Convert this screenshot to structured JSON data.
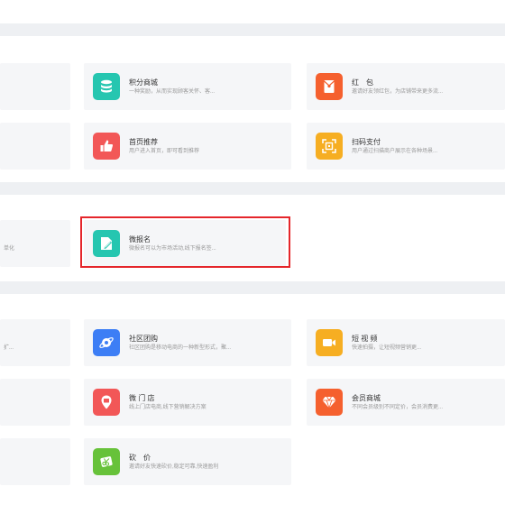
{
  "colors": {
    "highlight": "#e5262b",
    "teal": "#26c6b0",
    "orange_red": "#f5602e",
    "red": "#f25757",
    "amber": "#f6ae22",
    "blue": "#3d7ef5",
    "green": "#67c23a"
  },
  "section1": {
    "stubs": [
      {
        "desc": ""
      },
      {
        "desc": ""
      }
    ],
    "cards": [
      {
        "title": "积分商城",
        "desc": "一种奖励，从而实现顾客关怀、客...",
        "icon": "database-icon"
      },
      {
        "title": "红　包",
        "desc": "邀请好友领红包，为店铺带来更多流...",
        "icon": "red-envelope-icon"
      },
      {
        "title": "首页推荐",
        "desc": "用户进入首页，即可看到推荐",
        "icon": "thumbs-up-icon"
      },
      {
        "title": "扫码支付",
        "desc": "用户通过扫描商户展示在各种场景...",
        "icon": "scan-qr-icon"
      }
    ]
  },
  "section2": {
    "stubs": [
      {
        "desc": "单化"
      }
    ],
    "cards": [
      {
        "title": "微报名",
        "desc": "微报名可以为市场活动,线下报名签...",
        "icon": "edit-pen-icon"
      }
    ]
  },
  "section3": {
    "stubs": [
      {
        "desc": "扩..."
      },
      {
        "desc": ""
      },
      {
        "desc": ""
      }
    ],
    "cards": [
      {
        "title": "社区团购",
        "desc": "社区团购是移动电商的一种新型形式，聚...",
        "icon": "planet-icon"
      },
      {
        "title": "短 视 频",
        "desc": "快速拍摄，让短视频营销更...",
        "icon": "video-camera-icon"
      },
      {
        "title": "微 门 店",
        "desc": "线上门店电商,线下营销解决方案",
        "icon": "store-pin-icon"
      },
      {
        "title": "会员商城",
        "desc": "不同会员级别不同定价，会员消费更...",
        "icon": "diamond-icon"
      },
      {
        "title": "砍　价",
        "desc": "邀请好友快速砍价,稳定可靠,快速盈利",
        "icon": "scissors-tag-icon"
      }
    ]
  }
}
